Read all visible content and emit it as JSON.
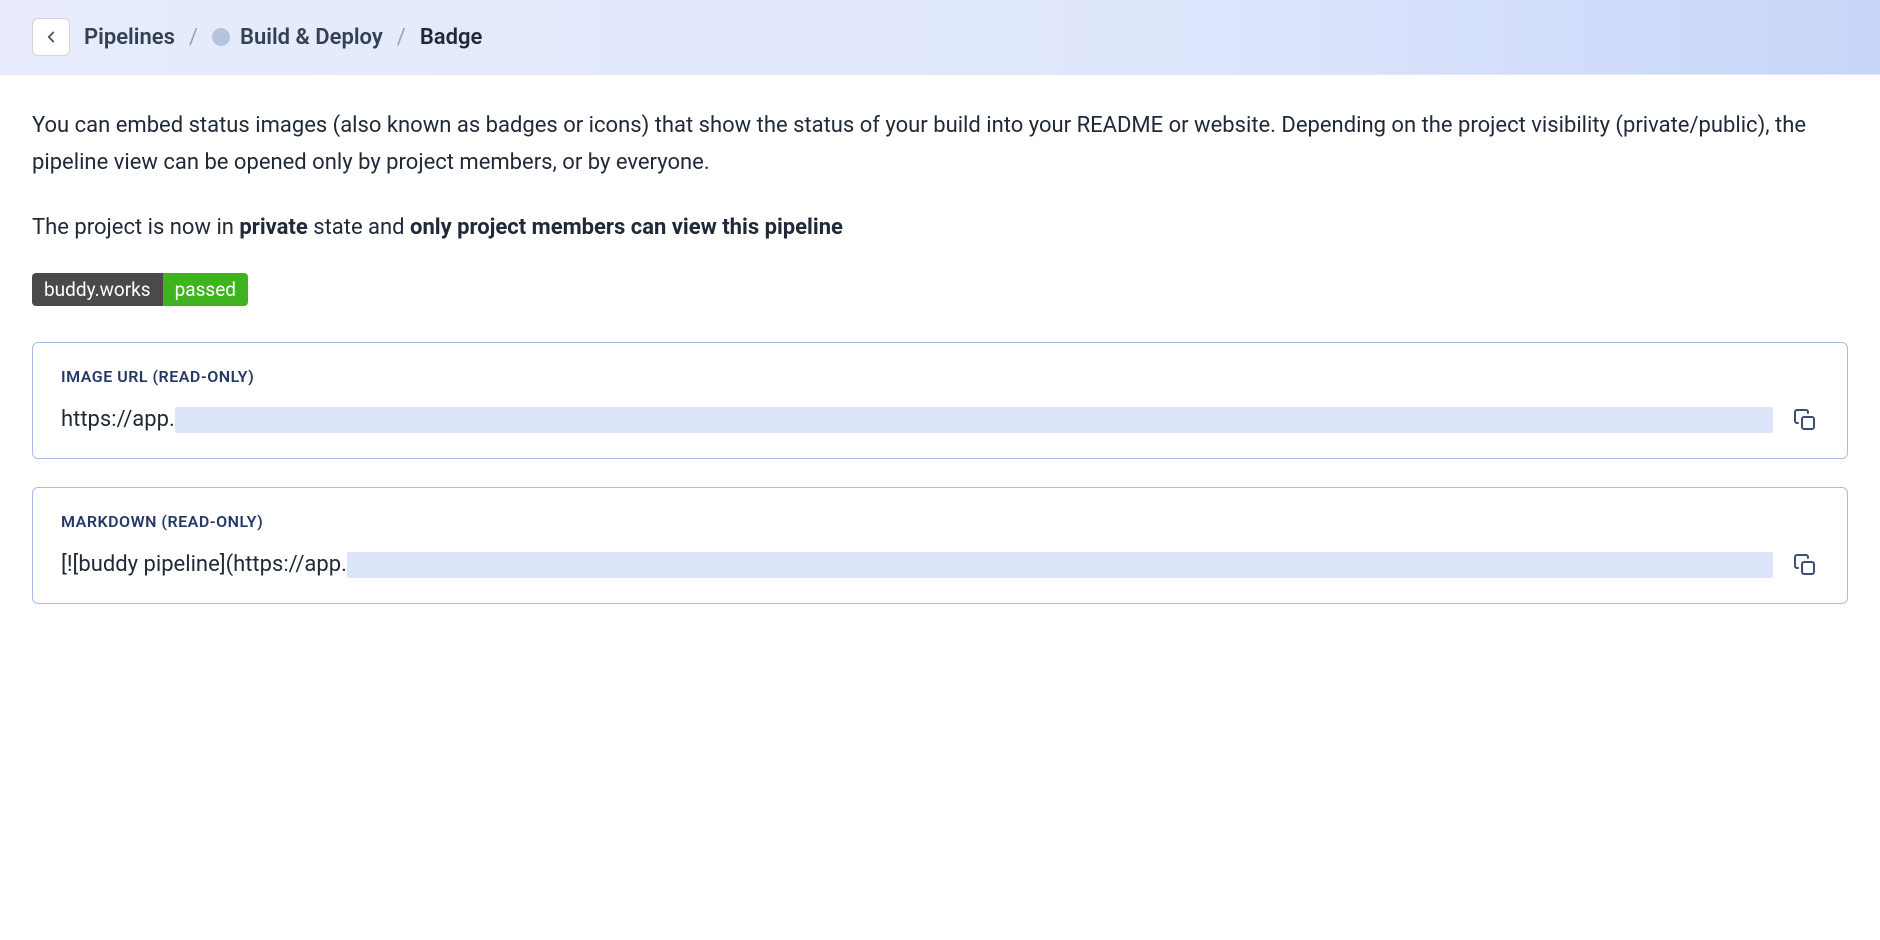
{
  "breadcrumb": {
    "pipelines": "Pipelines",
    "pipeline_name": "Build & Deploy",
    "current": "Badge"
  },
  "description": "You can embed status images (also known as badges or icons) that show the status of your build into your README or website. Depending on the project visibility (private/public), the pipeline view can be opened only by project members, or by everyone.",
  "status": {
    "prefix": "The project is now in ",
    "state": "private",
    "mid": " state and ",
    "visibility": "only project members can view this pipeline"
  },
  "badge": {
    "left": "buddy.works",
    "right": "passed"
  },
  "fields": {
    "image_url": {
      "label": "IMAGE URL (READ-ONLY)",
      "value_prefix": "https://app."
    },
    "markdown": {
      "label": "MARKDOWN (READ-ONLY)",
      "value_prefix": "[![buddy pipeline](https://app."
    }
  }
}
